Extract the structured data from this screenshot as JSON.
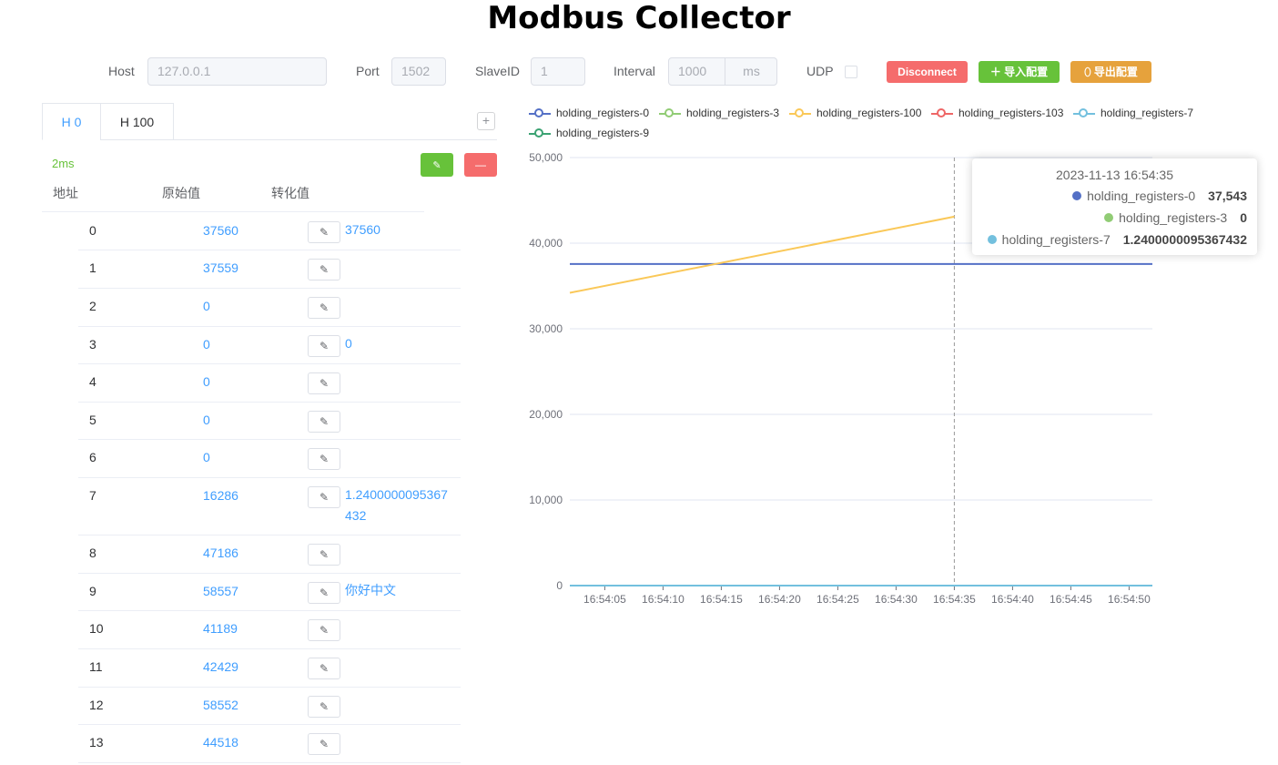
{
  "app": {
    "title": "Modbus Collector"
  },
  "connection": {
    "host_label": "Host",
    "host_placeholder": "127.0.0.1",
    "port_label": "Port",
    "port_placeholder": "1502",
    "slave_label": "SlaveID",
    "slave_placeholder": "1",
    "interval_label": "Interval",
    "interval_placeholder": "1000",
    "interval_unit": "ms",
    "udp_label": "UDP",
    "udp_checked": false,
    "disconnect_label": "Disconnect",
    "import_label": "＋ 导入配置",
    "export_label": "⬯ 导出配置",
    "colors": {
      "disconnect": "#f56c6c",
      "import": "#67c23a",
      "export": "#e6a23c"
    }
  },
  "tabs": [
    {
      "label": "H 0",
      "active": true
    },
    {
      "label": "H 100",
      "active": false
    }
  ],
  "add_tab_label": "+",
  "panel": {
    "latency": "2ms",
    "edit_icon": "✎",
    "remove_icon": "—",
    "columns": [
      "地址",
      "原始值",
      "转化值"
    ],
    "rows": [
      {
        "addr": "0",
        "raw": "37560",
        "converted": "37560"
      },
      {
        "addr": "1",
        "raw": "37559",
        "converted": ""
      },
      {
        "addr": "2",
        "raw": "0",
        "converted": ""
      },
      {
        "addr": "3",
        "raw": "0",
        "converted": "0"
      },
      {
        "addr": "4",
        "raw": "0",
        "converted": ""
      },
      {
        "addr": "5",
        "raw": "0",
        "converted": ""
      },
      {
        "addr": "6",
        "raw": "0",
        "converted": ""
      },
      {
        "addr": "7",
        "raw": "16286",
        "converted": "1.2400000095367432"
      },
      {
        "addr": "8",
        "raw": "47186",
        "converted": ""
      },
      {
        "addr": "9",
        "raw": "58557",
        "converted": "你好中文"
      },
      {
        "addr": "10",
        "raw": "41189",
        "converted": ""
      },
      {
        "addr": "11",
        "raw": "42429",
        "converted": ""
      },
      {
        "addr": "12",
        "raw": "58552",
        "converted": ""
      },
      {
        "addr": "13",
        "raw": "44518",
        "converted": ""
      }
    ]
  },
  "chart_data": {
    "type": "line",
    "title": "",
    "xlabel": "",
    "ylabel": "",
    "x_ticks": [
      "16:54:05",
      "16:54:10",
      "16:54:15",
      "16:54:20",
      "16:54:25",
      "16:54:30",
      "16:54:35",
      "16:54:40",
      "16:54:45",
      "16:54:50"
    ],
    "y_ticks": [
      "50,000",
      "40,000",
      "30,000",
      "20,000",
      "10,000",
      "0"
    ],
    "xlim": [
      "16:54:02",
      "16:54:52"
    ],
    "ylim": [
      0,
      50000
    ],
    "grid": true,
    "legend_position": "top",
    "series": [
      {
        "name": "holding_registers-0",
        "color": "#5470c6",
        "points": [
          [
            "16:54:02",
            37560
          ],
          [
            "16:54:52",
            37560
          ]
        ]
      },
      {
        "name": "holding_registers-3",
        "color": "#91cc75",
        "points": [
          [
            "16:54:02",
            0
          ],
          [
            "16:54:10",
            0
          ]
        ]
      },
      {
        "name": "holding_registers-100",
        "color": "#fac858",
        "points": [
          [
            "16:54:02",
            34200
          ],
          [
            "16:54:35",
            43100
          ]
        ]
      },
      {
        "name": "holding_registers-103",
        "color": "#ee6666",
        "points": []
      },
      {
        "name": "holding_registers-7",
        "color": "#73c0de",
        "points": [
          [
            "16:54:02",
            1.24
          ],
          [
            "16:54:52",
            1.24
          ]
        ]
      },
      {
        "name": "holding_registers-9",
        "color": "#3ba272",
        "points": []
      }
    ],
    "cursor_x": "16:54:35",
    "tooltip": {
      "time": "2023-11-13 16:54:35",
      "rows": [
        {
          "name": "holding_registers-0",
          "value": "37,543",
          "color": "#5470c6"
        },
        {
          "name": "holding_registers-3",
          "value": "0",
          "color": "#91cc75"
        },
        {
          "name": "holding_registers-7",
          "value": "1.2400000095367432",
          "color": "#73c0de"
        }
      ]
    }
  }
}
